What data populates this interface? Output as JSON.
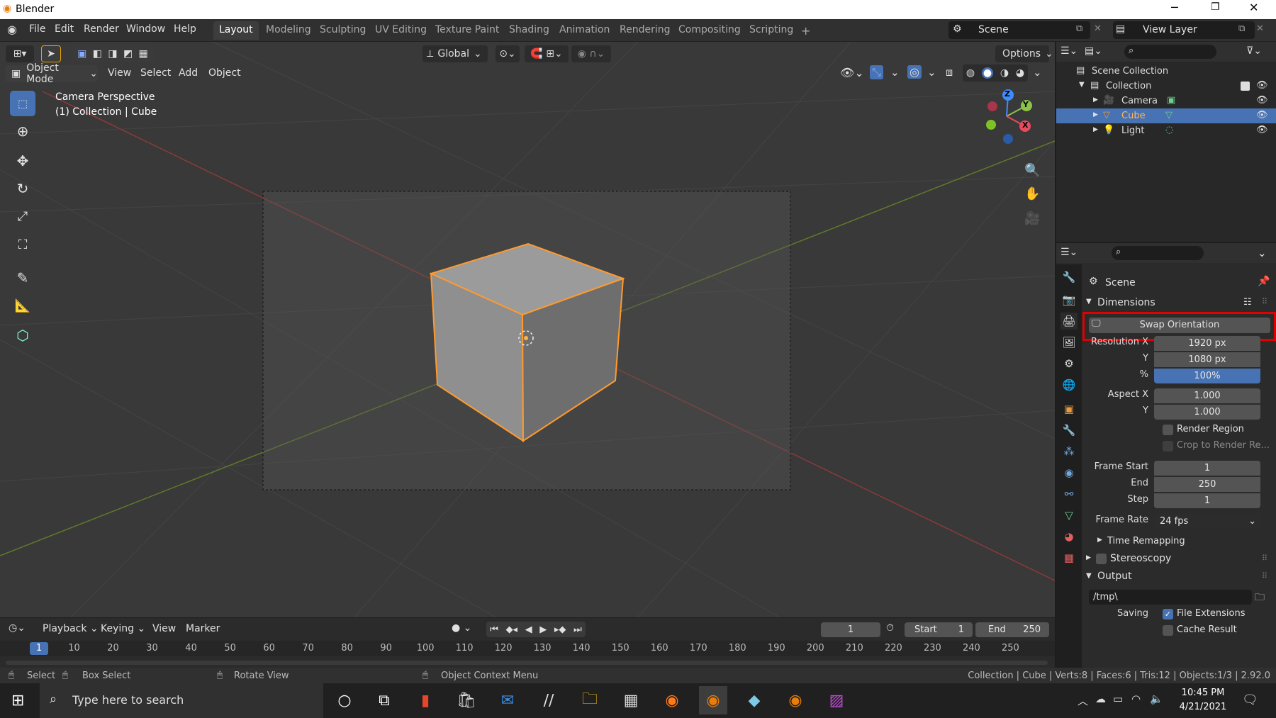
{
  "window": {
    "title": "Blender"
  },
  "menubar": {
    "menus": [
      "File",
      "Edit",
      "Render",
      "Window",
      "Help"
    ],
    "workspace_tabs": [
      "Layout",
      "Modeling",
      "Sculpting",
      "UV Editing",
      "Texture Paint",
      "Shading",
      "Animation",
      "Rendering",
      "Compositing",
      "Scripting"
    ],
    "add_tab": "+",
    "scene": "Scene",
    "view_layer": "View Layer"
  },
  "viewport": {
    "orientation": "Global",
    "options": "Options",
    "mode": "Object Mode",
    "menus": [
      "View",
      "Select",
      "Add",
      "Object"
    ],
    "camera_label": "Camera Perspective",
    "collection_label": "(1) Collection | Cube",
    "gizmo": {
      "z": "Z",
      "y": "Y",
      "x": "X"
    }
  },
  "outliner": {
    "root": "Scene Collection",
    "collection": "Collection",
    "items": [
      {
        "label": "Camera",
        "icon": "camera-icon"
      },
      {
        "label": "Cube",
        "icon": "mesh-icon",
        "selected": true
      },
      {
        "label": "Light",
        "icon": "light-icon"
      }
    ]
  },
  "properties": {
    "context": "Scene",
    "dimensions_header": "Dimensions",
    "swap_orientation": "Swap Orientation",
    "resolution_x_label": "Resolution X",
    "resolution_x": "1920 px",
    "resolution_y_label": "Y",
    "resolution_y": "1080 px",
    "resolution_pct_label": "%",
    "resolution_pct": "100%",
    "aspect_x_label": "Aspect X",
    "aspect_x": "1.000",
    "aspect_y_label": "Y",
    "aspect_y": "1.000",
    "render_region": "Render Region",
    "crop_region": "Crop to Render Re...",
    "frame_start_label": "Frame Start",
    "frame_start": "1",
    "frame_end_label": "End",
    "frame_end": "250",
    "frame_step_label": "Step",
    "frame_step": "1",
    "frame_rate_label": "Frame Rate",
    "frame_rate": "24 fps",
    "time_remapping": "Time Remapping",
    "stereoscopy": "Stereoscopy",
    "output_header": "Output",
    "output_path": "/tmp\\",
    "saving_label": "Saving",
    "file_extensions": "File Extensions",
    "cache_result": "Cache Result"
  },
  "timeline": {
    "menus": [
      "Playback",
      "Keying",
      "View",
      "Marker"
    ],
    "current_frame": "1",
    "start_label": "Start",
    "start": "1",
    "end_label": "End",
    "end": "250",
    "ruler": [
      "1",
      "10",
      "20",
      "30",
      "40",
      "50",
      "60",
      "70",
      "80",
      "90",
      "100",
      "110",
      "120",
      "130",
      "140",
      "150",
      "160",
      "170",
      "180",
      "190",
      "200",
      "210",
      "220",
      "230",
      "240",
      "250"
    ]
  },
  "statusbar": {
    "select": "Select",
    "box_select": "Box Select",
    "rotate_view": "Rotate View",
    "context_menu": "Object Context Menu",
    "stats": "Collection | Cube | Verts:8 | Faces:6 | Tris:12 | Objects:1/3 | 2.92.0"
  },
  "taskbar": {
    "search_placeholder": "Type here to search",
    "time": "10:45 PM",
    "date": "4/21/2021"
  },
  "colors": {
    "accent": "#4772b3",
    "highlight_box": "#e00000",
    "selection_orange": "#ffa032"
  }
}
